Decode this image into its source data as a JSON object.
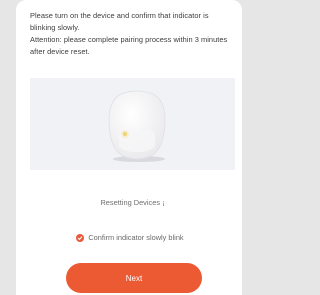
{
  "instructions": {
    "line1": "Please turn on the device and confirm that indicator is blinking slowly.",
    "line2": "Attention: please complete pairing process within 3 minutes after device reset."
  },
  "illustration": {
    "icon": "smart-plug-device-icon",
    "indicator_color": "#f2d36b"
  },
  "caption": "Resetting Devices ¡",
  "confirm": {
    "label": "Confirm indicator slowly blink",
    "checked": true,
    "icon": "check-icon",
    "color": "#e8583a"
  },
  "next_button": {
    "label": "Next",
    "color": "#ec5a33"
  }
}
